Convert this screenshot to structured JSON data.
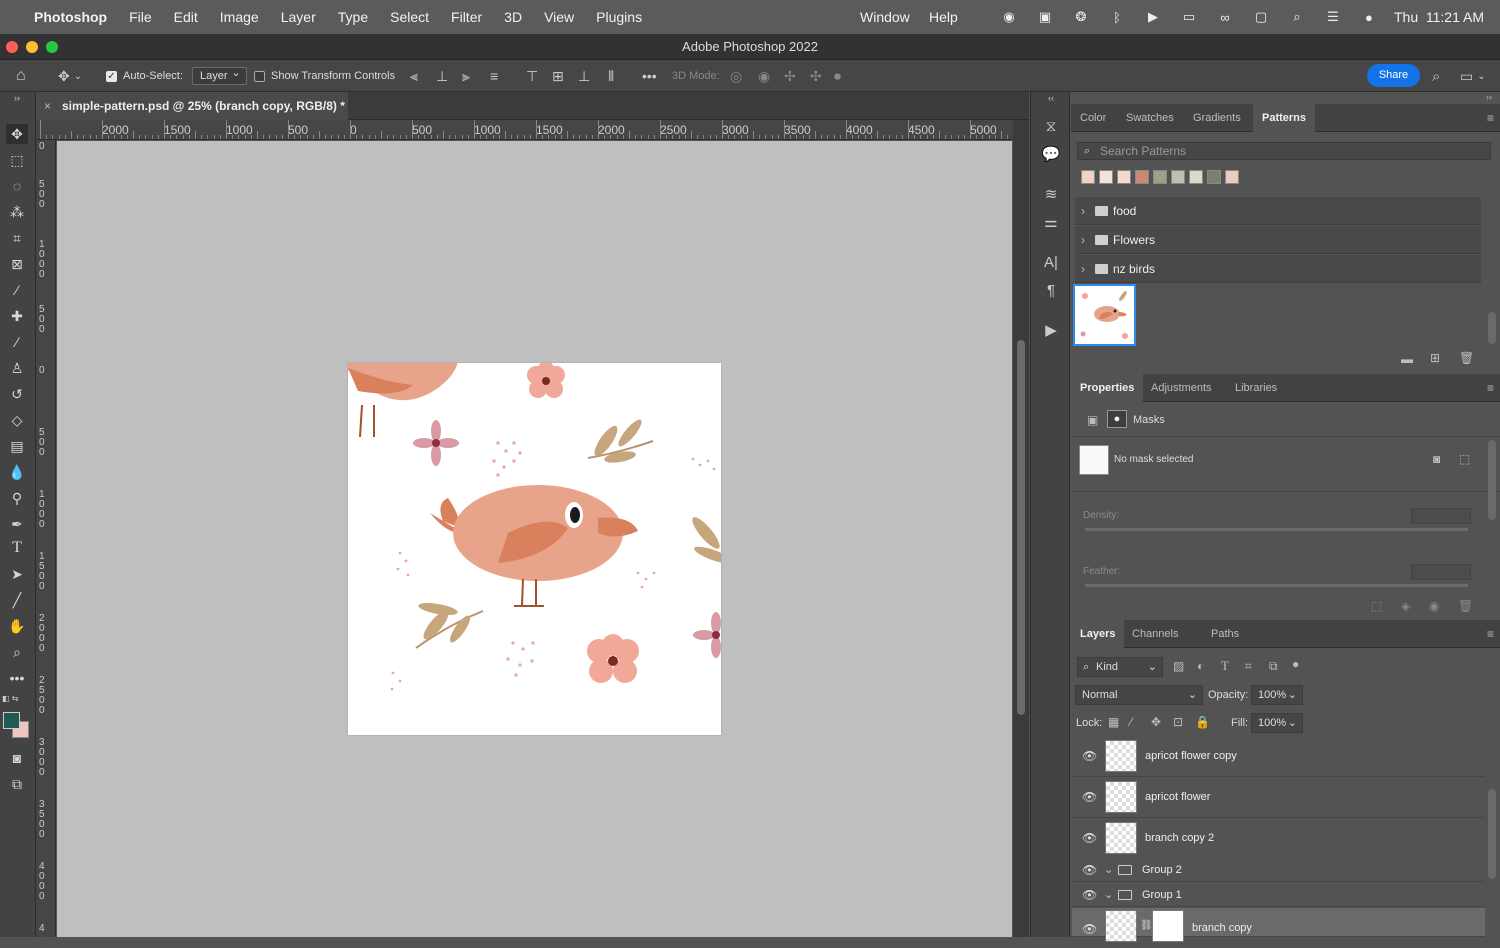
{
  "menubar": {
    "app": "Photoshop",
    "items": [
      "File",
      "Edit",
      "Image",
      "Layer",
      "Type",
      "Select",
      "Filter",
      "3D",
      "View",
      "Plugins"
    ],
    "right_items": [
      "Window",
      "Help"
    ],
    "clock": "Thu  11:21 AM"
  },
  "window": {
    "title": "Adobe Photoshop 2022"
  },
  "options": {
    "auto_select_label": "Auto-Select:",
    "auto_select_value": "Layer",
    "show_transform_label": "Show Transform Controls",
    "mode_3d_label": "3D Mode:",
    "share_label": "Share"
  },
  "document": {
    "tab_title": "simple-pattern.psd @ 25% (branch copy, RGB/8) *",
    "close_glyph": "×"
  },
  "ruler": {
    "h_labels": [
      "2000",
      "1500",
      "1000",
      "500",
      "0",
      "500",
      "1000",
      "1500",
      "2000",
      "2500",
      "3000",
      "3500",
      "4000",
      "4500",
      "5000"
    ],
    "v_labels": [
      "0",
      "500",
      "1000",
      "500",
      "0",
      "500",
      "1000",
      "1500",
      "2000",
      "2500",
      "3000",
      "3500",
      "4000",
      "4"
    ]
  },
  "patterns_panel": {
    "tabs": [
      "Color",
      "Swatches",
      "Gradients",
      "Patterns"
    ],
    "active_tab": "Patterns",
    "search_placeholder": "Search Patterns",
    "folders": [
      "food",
      "Flowers",
      "nz birds"
    ],
    "swatch_colors": [
      "#f1d3c4",
      "#f6e2d8",
      "#f3d9cf",
      "#c98a72",
      "#9aa289",
      "#b9c2b1",
      "#d8dccd",
      "#7a7f6e",
      "#f0c9c0"
    ]
  },
  "properties_panel": {
    "tabs": [
      "Properties",
      "Adjustments",
      "Libraries"
    ],
    "active_tab": "Properties",
    "masks_label": "Masks",
    "no_mask": "No mask selected",
    "density_label": "Density:",
    "feather_label": "Feather:"
  },
  "layers_panel": {
    "tabs": [
      "Layers",
      "Channels",
      "Paths"
    ],
    "active_tab": "Layers",
    "kind_label": "Kind",
    "blend_mode": "Normal",
    "opacity_label": "Opacity:",
    "opacity_value": "100%",
    "lock_label": "Lock:",
    "fill_label": "Fill:",
    "fill_value": "100%",
    "layers": [
      {
        "name": "apricot flower copy",
        "type": "smart"
      },
      {
        "name": "apricot flower",
        "type": "smart"
      },
      {
        "name": "branch copy 2",
        "type": "smart"
      }
    ],
    "groups": [
      "Group 2",
      "Group 1"
    ],
    "selected_layer": "branch copy"
  },
  "colors": {
    "foreground": "#1f5a55",
    "background": "#f2c4c0",
    "accent": "#1473e6",
    "bird": "#e8a48a",
    "bird_wing": "#d9805c",
    "leaf": "#c7a67e",
    "flower": "#f2a899"
  }
}
